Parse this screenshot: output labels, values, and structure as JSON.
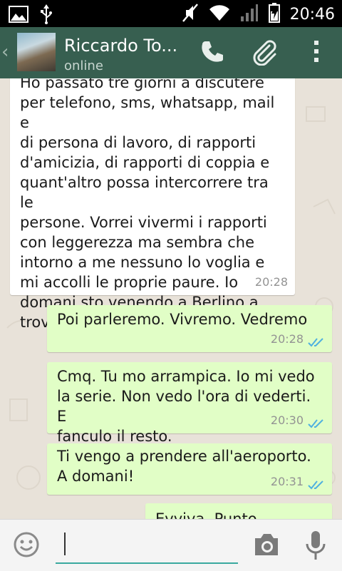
{
  "status_bar": {
    "time": "20:46",
    "icons": [
      "image-icon",
      "usb-icon",
      "mute-icon",
      "wifi-icon",
      "signal-icon",
      "battery-charging-icon"
    ]
  },
  "header": {
    "contact_name": "Riccardo To...",
    "contact_status": "online",
    "actions": [
      "call-icon",
      "attach-icon",
      "overflow-menu-icon"
    ]
  },
  "messages": [
    {
      "direction": "in",
      "text": "Ho passato tre giorni a discutere\nper telefono, sms, whatsapp, mail e\ndi persona di lavoro, di rapporti\nd'amicizia, di rapporti di coppia e\nquant'altro possa intercorrere tra le\npersone. Vorrei vivermi i rapporti\ncon leggerezza ma sembra che\nintorno a me nessuno lo voglia e\nmi accolli le proprie paure. Io\ndomani sto venendo a Berlino a\ntrovare te. Punto.",
      "time": "20:28"
    },
    {
      "direction": "out",
      "text": "Poi parleremo. Vivremo. Vedremo",
      "time": "20:28",
      "status": "read"
    },
    {
      "direction": "out",
      "text": "Cmq. Tu mo arrampica. Io mi vedo\nla serie. Non vedo l'ora di vederti. E\nfanculo il resto.",
      "time": "20:30",
      "status": "read"
    },
    {
      "direction": "out",
      "text": "Ti vengo a prendere all'aeroporto.\nA domani!",
      "time": "20:31",
      "status": "read"
    },
    {
      "direction": "out",
      "text": "Evviva. Punto.",
      "time": "",
      "status": ""
    }
  ],
  "composer": {
    "value": "",
    "placeholder": ""
  },
  "colors": {
    "action_bar": "#375f50",
    "outgoing_bubble": "#e1fec6",
    "incoming_bubble": "#ffffff",
    "read_ticks": "#4fb0e0",
    "input_underline": "#3aa99f"
  }
}
